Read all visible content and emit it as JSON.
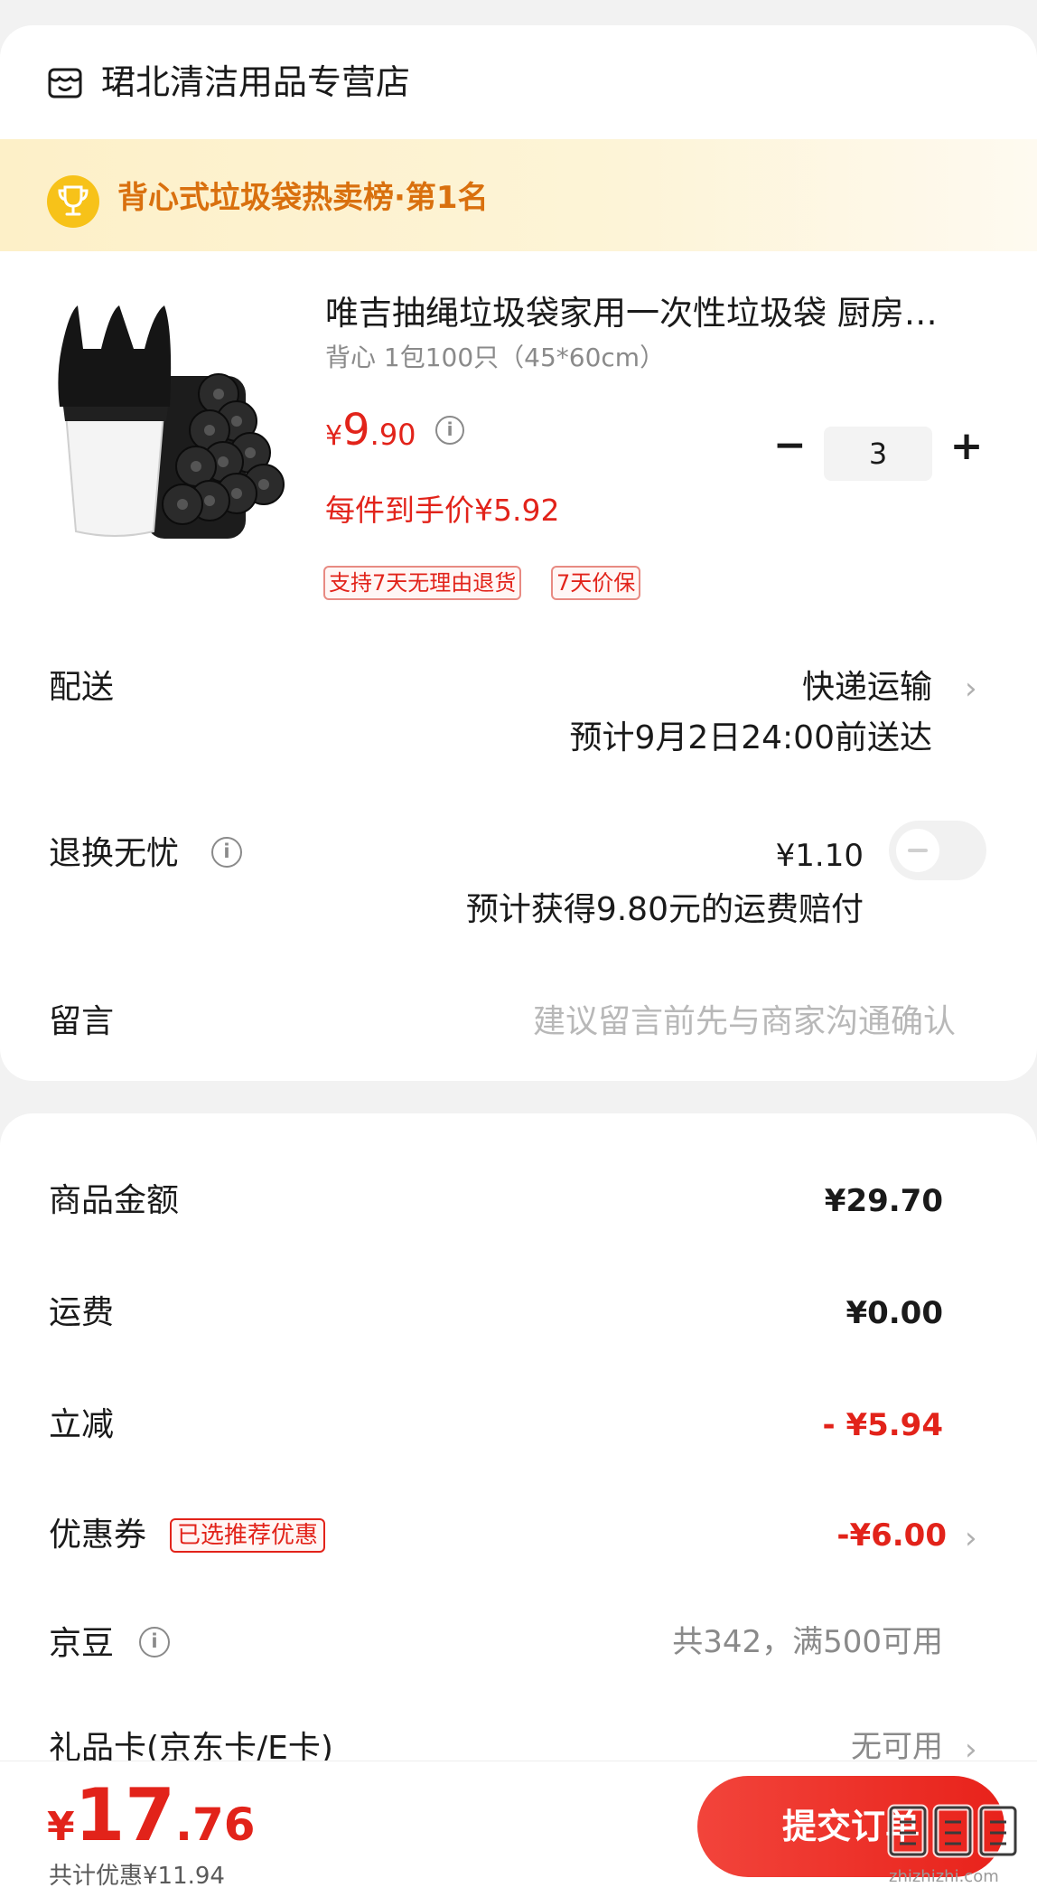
{
  "store": {
    "name": "珺北清洁用品专营店",
    "icon": "store-icon"
  },
  "rank_banner": {
    "text": "背心式垃圾袋热卖榜·第1名",
    "icon": "trophy-icon"
  },
  "product": {
    "title": "唯吉抽绳垃圾袋家用一次性垃圾袋 厨房…",
    "spec": "背心 1包100只（45*60cm）",
    "price_currency": "¥",
    "price_int": "9",
    "price_dec": ".90",
    "unit_price": "每件到手价¥5.92",
    "tags": [
      "支持7天无理由退货",
      "7天价保"
    ],
    "quantity": "3"
  },
  "delivery": {
    "label": "配送",
    "method": "快递运输",
    "eta": "预计9月2日24:00前送达"
  },
  "return_insurance": {
    "label": "退换无忧",
    "price": "¥1.10",
    "compensation": "预计获得9.80元的运费赔付",
    "enabled": false
  },
  "message": {
    "label": "留言",
    "placeholder": "建议留言前先与商家沟通确认"
  },
  "summary": {
    "goods_label": "商品金额",
    "goods_value": "¥29.70",
    "freight_label": "运费",
    "freight_value": "¥0.00",
    "discount_label": "立减",
    "discount_value": "- ¥5.94",
    "coupon_label": "优惠券",
    "coupon_tag": "已选推荐优惠",
    "coupon_value": "-¥6.00",
    "bean_label": "京豆",
    "bean_value": "共342，满500可用",
    "giftcard_label": "礼品卡(京东卡/E卡)",
    "giftcard_value": "无可用"
  },
  "bottom": {
    "total_currency": "¥",
    "total_int": "17",
    "total_dec": ".76",
    "saved": "共计优惠¥11.94",
    "submit_label": "提交订单"
  },
  "watermark": {
    "text": "zhizhizhi.com"
  },
  "colors": {
    "accent_red": "#e2231a",
    "banner_orange": "#d9700e",
    "trophy_yellow": "#f7c219"
  }
}
